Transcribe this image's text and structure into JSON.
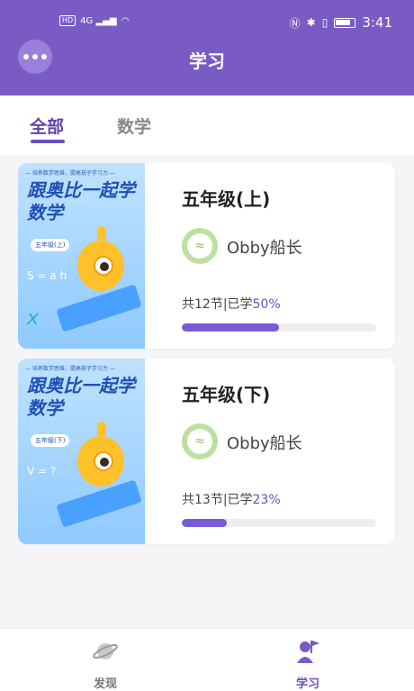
{
  "status_bar": {
    "left": "HD 4G",
    "time": "3:41"
  },
  "header": {
    "title": "学习"
  },
  "tabs": [
    {
      "label": "全部",
      "active": true
    },
    {
      "label": "数学",
      "active": false
    }
  ],
  "courses": [
    {
      "cover_tag": "— 培养数学思维，提高孩子学习力 —",
      "cover_title": "跟奥比一起学数学",
      "cover_grade": "五年级(上)",
      "cover_math_1": "S = a h",
      "cover_math_2": "x",
      "title": "五年级(上)",
      "teacher": "Obby船长",
      "progress_prefix": "共12节|已学",
      "progress_pct": "50%",
      "progress_value": 0.5
    },
    {
      "cover_tag": "— 培养数学思维，提高孩子学习力 —",
      "cover_title": "跟奥比一起学数学",
      "cover_grade": "五年级(下)",
      "cover_math_1": "V = ?",
      "cover_math_2": "",
      "title": "五年级(下)",
      "teacher": "Obby船长",
      "progress_prefix": "共13节|已学",
      "progress_pct": "23%",
      "progress_value": 0.23
    }
  ],
  "bottom_nav": [
    {
      "label": "发现",
      "icon": "planet-icon",
      "active": false
    },
    {
      "label": "学习",
      "icon": "flag-person-icon",
      "active": true
    }
  ],
  "colors": {
    "accent": "#7a5bc4",
    "progress": "#7a5bd6"
  }
}
